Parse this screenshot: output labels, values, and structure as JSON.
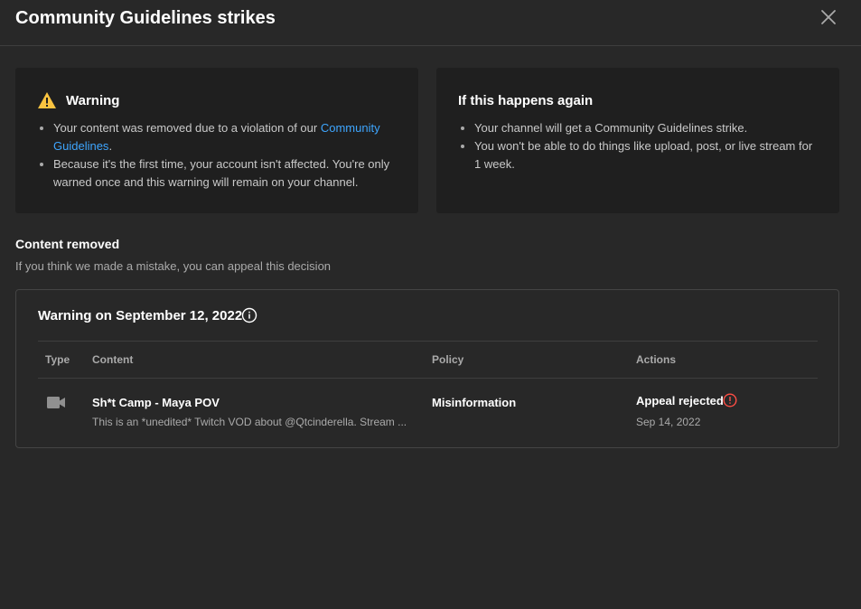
{
  "dialog": {
    "title": "Community Guidelines strikes",
    "close_icon": "close-icon"
  },
  "warning_card": {
    "icon": "warning-triangle-icon",
    "title": "Warning",
    "bullet1_prefix": "Your content was removed due to a violation of our ",
    "bullet1_link": "Community Guidelines",
    "bullet1_suffix": ".",
    "bullet2": "Because it's the first time, your account isn't affected. You're only warned once and this warning will remain on your channel."
  },
  "again_card": {
    "title": "If this happens again",
    "bullets": [
      "Your channel will get a Community Guidelines strike.",
      "You won't be able to do things like upload, post, or live stream for 1 week."
    ]
  },
  "content_removed": {
    "title": "Content removed",
    "subtitle": "If you think we made a mistake, you can appeal this decision"
  },
  "strike": {
    "title": "Warning on September 12, 2022",
    "info_icon": "info-icon",
    "columns": {
      "type": "Type",
      "content": "Content",
      "policy": "Policy",
      "actions": "Actions"
    },
    "row": {
      "type_icon": "video-camera-icon",
      "video_title": "Sh*t Camp - Maya POV",
      "video_description": "This is an *unedited* Twitch VOD about @Qtcinderella. Stream ...",
      "policy": "Misinformation",
      "action_status": "Appeal rejected",
      "action_icon": "alert-circle-icon",
      "action_date": "Sep 14, 2022"
    }
  },
  "colors": {
    "background": "#282828",
    "card": "#1f1f1f",
    "link": "#3ea6ff",
    "warning": "#f9c340",
    "alert": "#ff4e45",
    "muted_text": "#aaaaaa"
  }
}
